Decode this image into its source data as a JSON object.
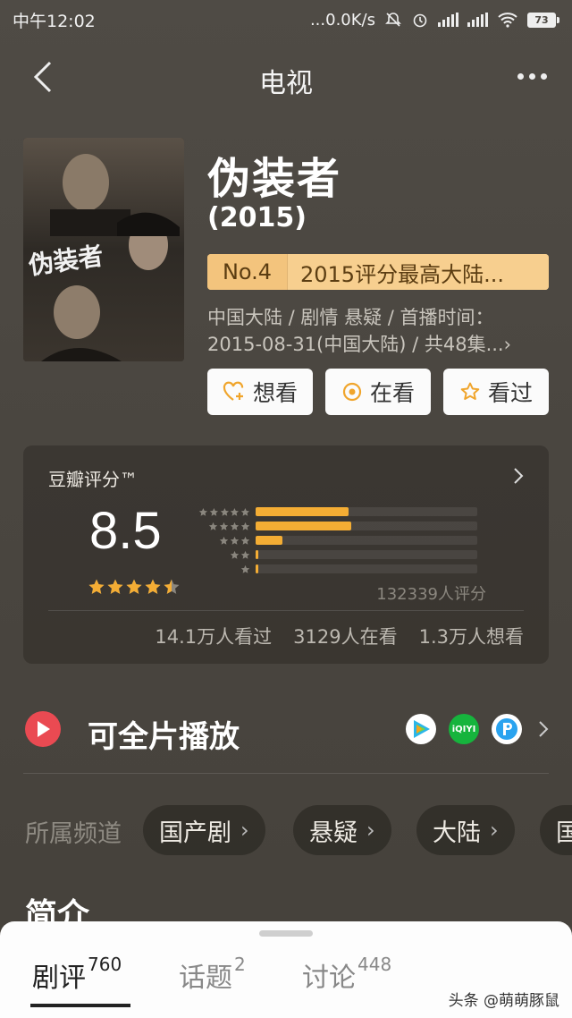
{
  "status_bar": {
    "time": "中午12:02",
    "network_speed": "...0.0K/s",
    "battery": "73"
  },
  "nav": {
    "title": "电视"
  },
  "show": {
    "title": "伪装者",
    "poster_text": "伪装者",
    "year": "(2015)",
    "rank_no": "No.4",
    "rank_text": "2015评分最高大陆...",
    "meta_line1": "中国大陆 / 剧情 悬疑 / 首播时间：",
    "meta_line2": "2015-08-31(中国大陆) / 共48集...›"
  },
  "actions": {
    "want": "想看",
    "watching": "在看",
    "watched": "看过"
  },
  "rating": {
    "label": "豆瓣评分™",
    "score": "8.5",
    "star_value": 4.5,
    "distribution": [
      0.42,
      0.43,
      0.12,
      0.012,
      0.008
    ],
    "raters": "132339人评分",
    "watched_count": "14.1万人看过",
    "watching_count": "3129人在看",
    "want_count": "1.3万人想看"
  },
  "play": {
    "label": "可全片播放",
    "platforms": [
      "tencent-video",
      "iqiyi",
      "pptv"
    ]
  },
  "channels": {
    "label": "所属频道",
    "items": [
      "国产剧",
      "悬疑",
      "大陆",
      "国"
    ]
  },
  "intro": {
    "title": "简介"
  },
  "sheet": {
    "tabs": [
      {
        "label": "剧评",
        "count": "760"
      },
      {
        "label": "话题",
        "count": "2"
      },
      {
        "label": "讨论",
        "count": "448"
      }
    ],
    "watermark": "头条 @萌萌豚鼠"
  },
  "colors": {
    "accent_star": "#f4ad34",
    "rank_badge": "#f7cf8f",
    "play_red": "#ea4a52"
  }
}
